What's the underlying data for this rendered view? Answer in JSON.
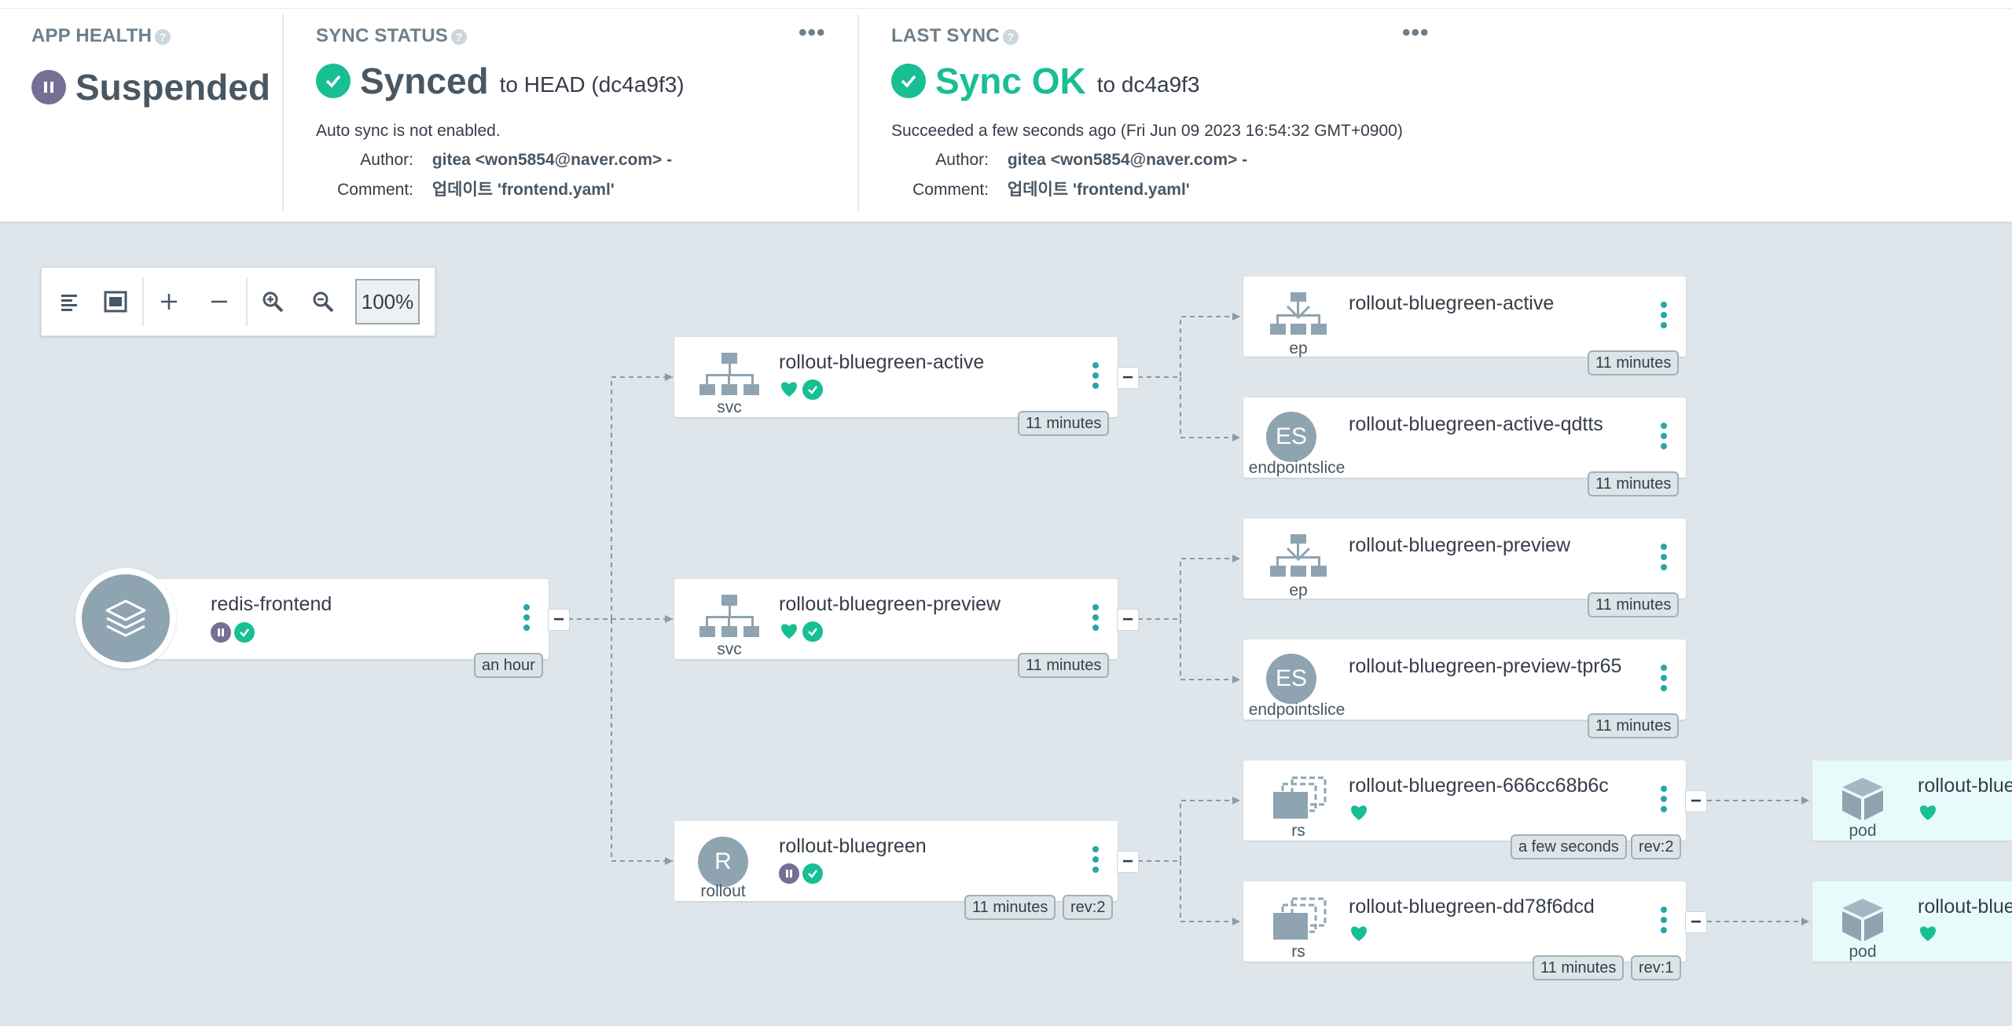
{
  "app_health": {
    "title": "APP HEALTH",
    "status": "Suspended",
    "status_color": "#766f94"
  },
  "sync_status": {
    "title": "SYNC STATUS",
    "status": "Synced",
    "target": "to HEAD (dc4a9f3)",
    "auto_sync": "Auto sync is not enabled.",
    "author_label": "Author:",
    "author": "gitea <won5854@naver.com> -",
    "comment_label": "Comment:",
    "comment": "업데이트 'frontend.yaml'",
    "status_color": "#18be94"
  },
  "last_sync": {
    "title": "LAST SYNC",
    "status": "Sync OK",
    "target": "to dc4a9f3",
    "result": "Succeeded a few seconds ago (Fri Jun 09 2023 16:54:32 GMT+0900)",
    "author_label": "Author:",
    "author": "gitea <won5854@naver.com> -",
    "comment_label": "Comment:",
    "comment": "업데이트 'frontend.yaml'",
    "status_color": "#18be94"
  },
  "toolbar": {
    "zoom": "100%",
    "buttons": [
      "list-view-icon",
      "fit-view-icon",
      "zoom-in-icon",
      "zoom-out-icon",
      "zoom-in-magnifier-icon",
      "zoom-out-magnifier-icon"
    ]
  },
  "nodes": {
    "app": {
      "name": "redis-frontend",
      "age": "an hour"
    },
    "svc_active": {
      "name": "rollout-bluegreen-active",
      "kind": "svc",
      "age": "11 minutes"
    },
    "svc_preview": {
      "name": "rollout-bluegreen-preview",
      "kind": "svc",
      "age": "11 minutes"
    },
    "rollout": {
      "name": "rollout-bluegreen",
      "kind": "rollout",
      "icon_letter": "R",
      "age": "11 minutes",
      "rev": "rev:2"
    },
    "ep_active": {
      "name": "rollout-bluegreen-active",
      "kind": "ep",
      "age": "11 minutes"
    },
    "es_active": {
      "name": "rollout-bluegreen-active-qdtts",
      "kind": "endpointslice",
      "icon_letter": "ES",
      "age": "11 minutes"
    },
    "ep_preview": {
      "name": "rollout-bluegreen-preview",
      "kind": "ep",
      "age": "11 minutes"
    },
    "es_preview": {
      "name": "rollout-bluegreen-preview-tpr65",
      "kind": "endpointslice",
      "icon_letter": "ES",
      "age": "11 minutes"
    },
    "rs1": {
      "name": "rollout-bluegreen-666cc68b6c",
      "kind": "rs",
      "age": "a few seconds",
      "rev": "rev:2"
    },
    "rs2": {
      "name": "rollout-bluegreen-dd78f6dcd",
      "kind": "rs",
      "age": "11 minutes",
      "rev": "rev:1"
    },
    "pod1": {
      "name": "rollout-blue",
      "kind": "pod"
    },
    "pod2": {
      "name": "rollout-blue",
      "kind": "pod"
    }
  },
  "colors": {
    "healthy": "#18be94",
    "suspended": "#766f94",
    "accent": "#2aa5a5",
    "icon_gray": "#8fa4b1"
  }
}
